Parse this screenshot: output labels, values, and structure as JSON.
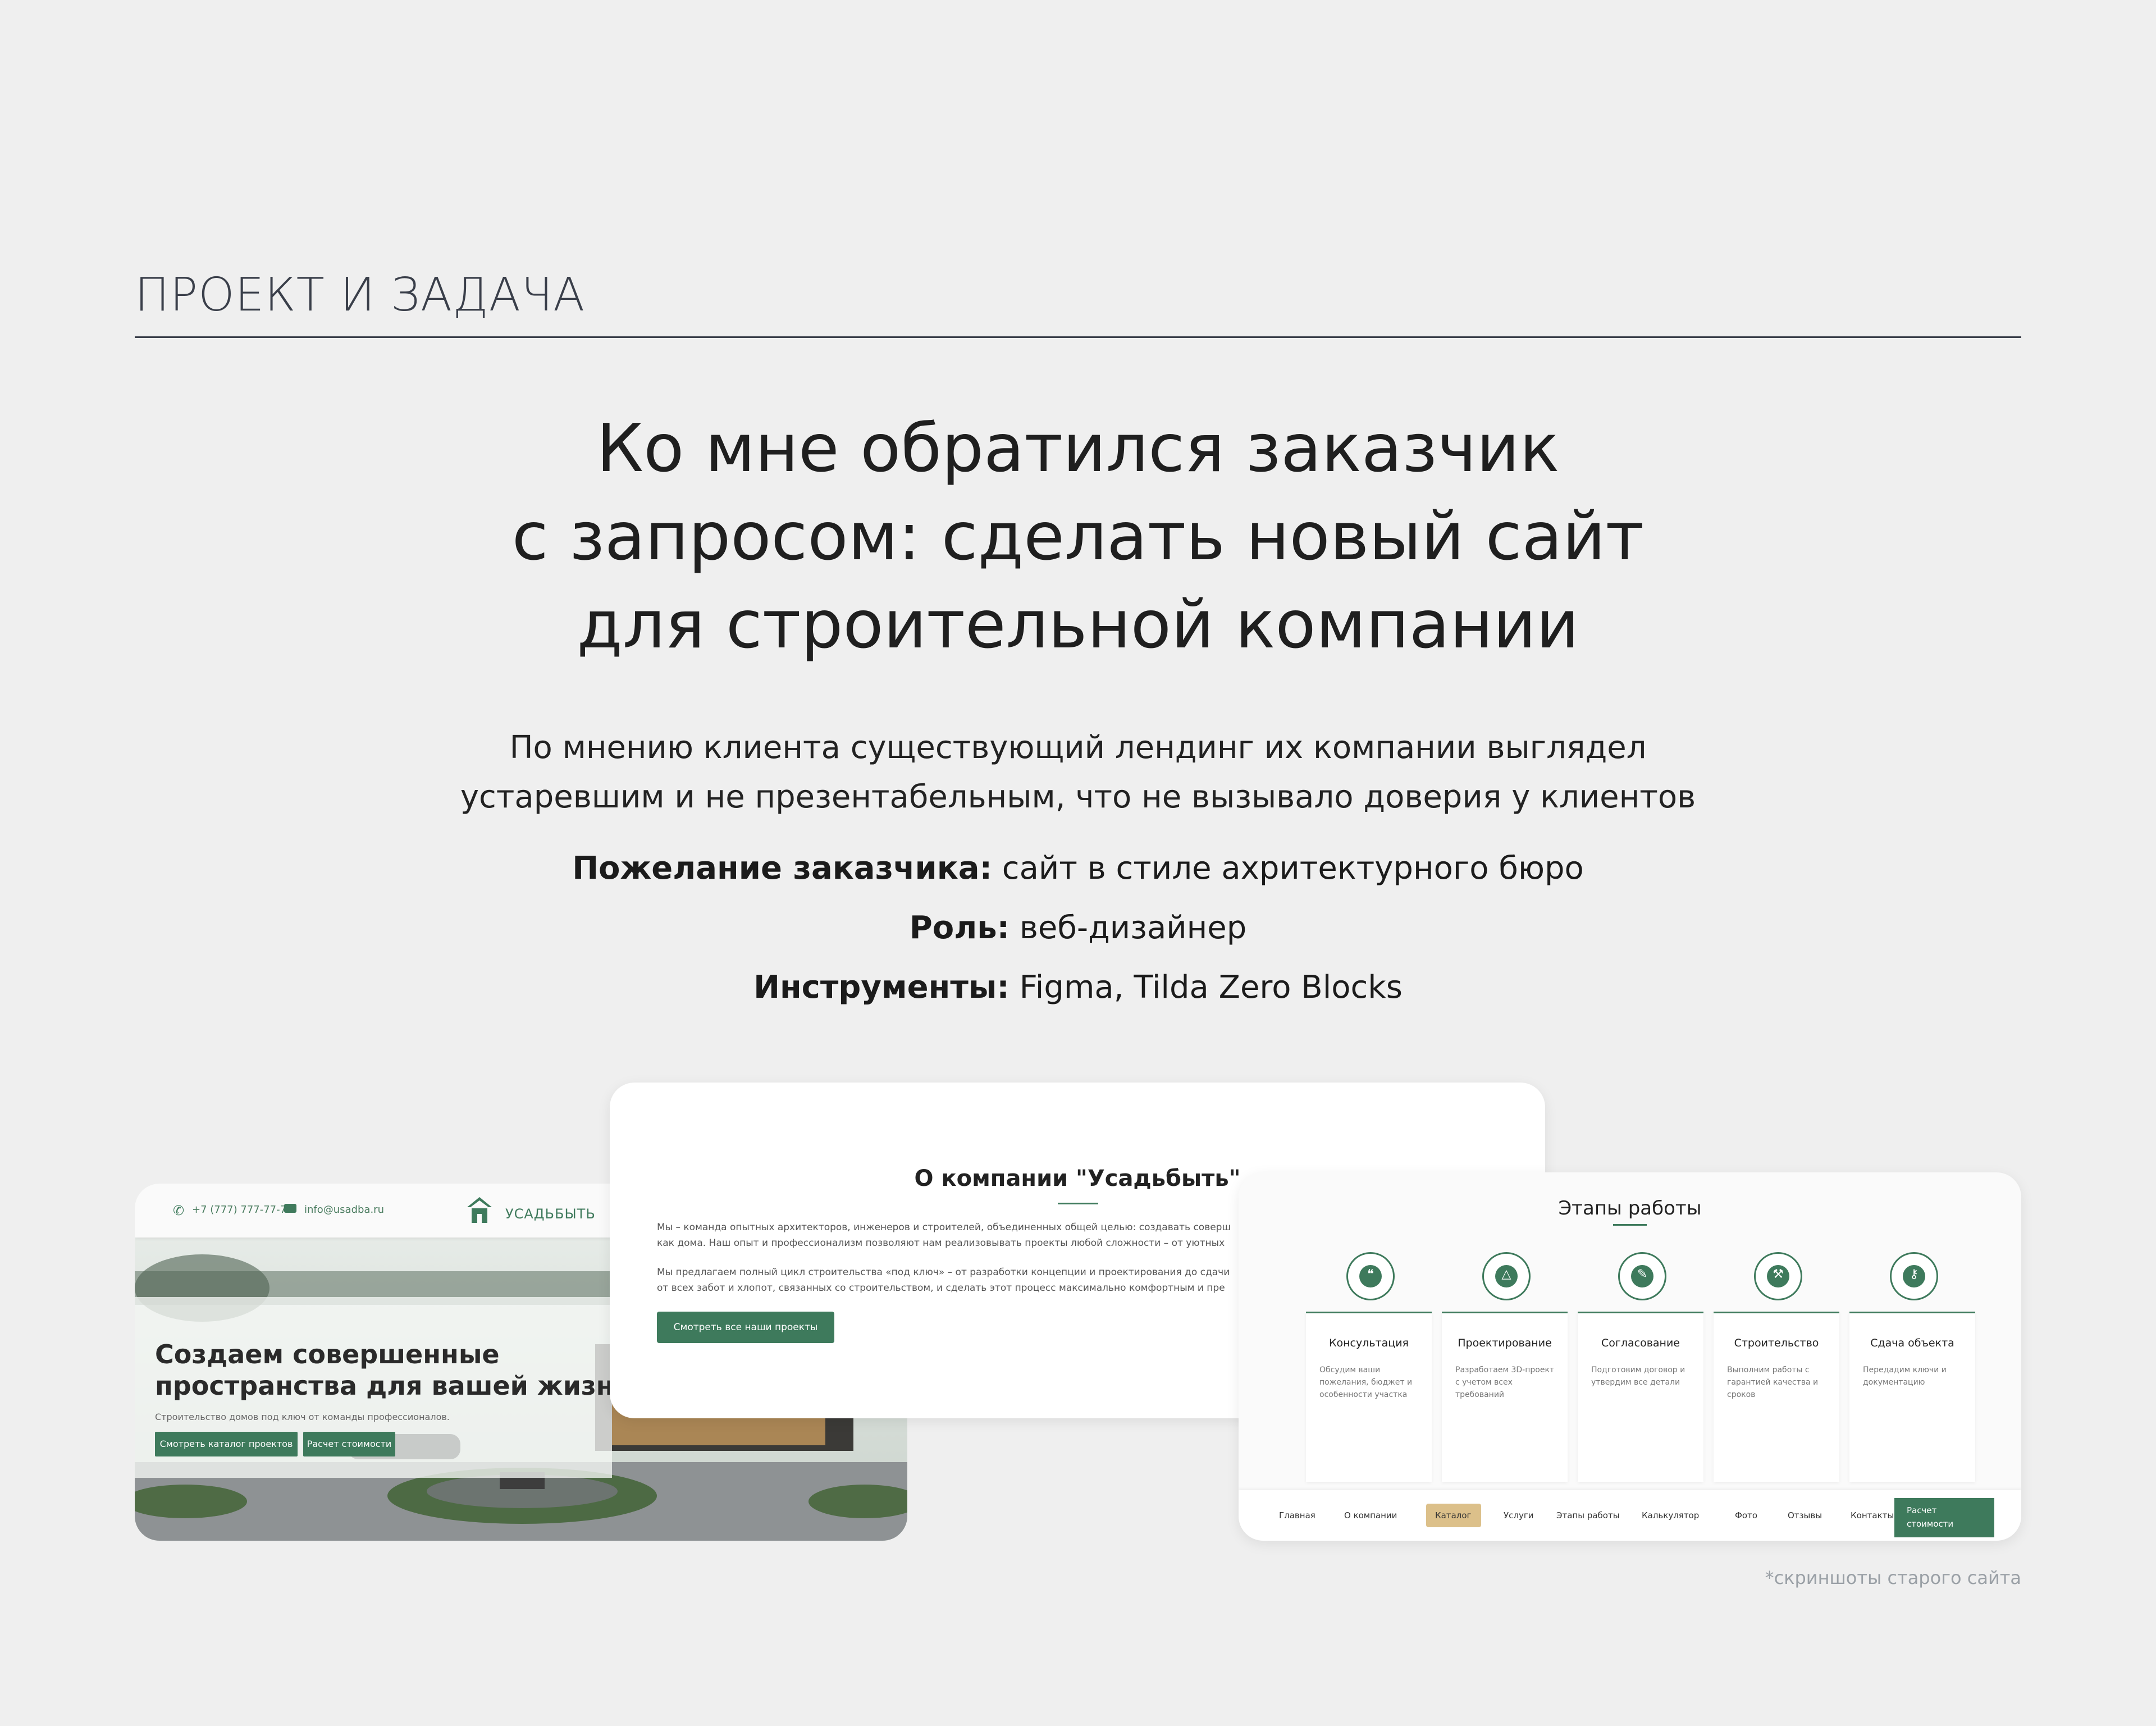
{
  "section": {
    "title": "ПРОЕКТ И ЗАДАЧА"
  },
  "headline": {
    "line1": "Ко мне обратился заказчик",
    "line2": "с запросом: сделать новый сайт",
    "line3": "для строительной компании"
  },
  "intro": {
    "line1": "По мнению клиента существующий лендинг их компании выглядел",
    "line2": "устаревшим и не презентабельным, что не вызывало доверия у клиентов"
  },
  "info": {
    "wish_label": "Пожелание заказчика:",
    "wish_value": " сайт в стиле ахритектурного бюро",
    "role_label": "Роль:",
    "role_value": " веб-дизайнер",
    "tools_label": "Инструменты:",
    "tools_value": " Figma, Tilda Zero Blocks"
  },
  "old_site_hero": {
    "phone": "+7 (777) 777-77-77",
    "email": "info@usadba.ru",
    "logo_text": "УСАДЬБЫТЬ",
    "title_line1": "Создаем совершенные",
    "title_line2": "пространства для вашей жизни",
    "subtitle": "Строительство домов под ключ от команды профессионалов.",
    "btn_catalog": "Смотреть каталог проектов",
    "btn_calc": "Расчет стоимости"
  },
  "old_site_about": {
    "title": "О компании \"Усадьбыть\"",
    "p1_line1": "Мы – команда опытных архитекторов, инженеров и строителей, объединенных общей целью: создавать соверш",
    "p1_line2": "как дома. Наш опыт и профессионализм позволяют нам реализовывать проекты любой сложности – от уютных",
    "p2_line1": "Мы предлагаем полный цикл строительства «под ключ» – от разработки концепции и проектирования до сдачи",
    "p2_line2": "от всех забот и хлопот, связанных со строительством, и сделать этот процесс максимально комфортным и пре",
    "button": "Смотреть все наши проекты"
  },
  "old_site_stages": {
    "title": "Этапы работы",
    "stages": [
      {
        "title": "Консультация",
        "text": "Обсудим ваши пожелания, бюджет и особенности участка",
        "icon": "chat-icon"
      },
      {
        "title": "Проектирование",
        "text": "Разработаем 3D-проект с учетом всех требований",
        "icon": "compass-icon"
      },
      {
        "title": "Согласование",
        "text": "Подготовим договор и утвердим все детали",
        "icon": "document-icon"
      },
      {
        "title": "Строительство",
        "text": "Выполним работы с гарантией качества и сроков",
        "icon": "hammer-icon"
      },
      {
        "title": "Сдача объекта",
        "text": "Передадим ключи и документацию",
        "icon": "key-icon"
      }
    ],
    "nav": [
      "Главная",
      "О компании",
      "Каталог",
      "Услуги",
      "Этапы работы",
      "Калькулятор",
      "Фото",
      "Отзывы",
      "Контакты"
    ],
    "nav_active": "Каталог",
    "nav_cta_line1": "Расчет",
    "nav_cta_line2": "стоимости"
  },
  "footnote": "*скриншоты старого сайта",
  "colors": {
    "background": "#efefef",
    "brand_green": "#3e7a5c",
    "nav_active": "#dcc08a",
    "text_dark": "#1f1f1f",
    "footnote": "#9aa0a6"
  }
}
